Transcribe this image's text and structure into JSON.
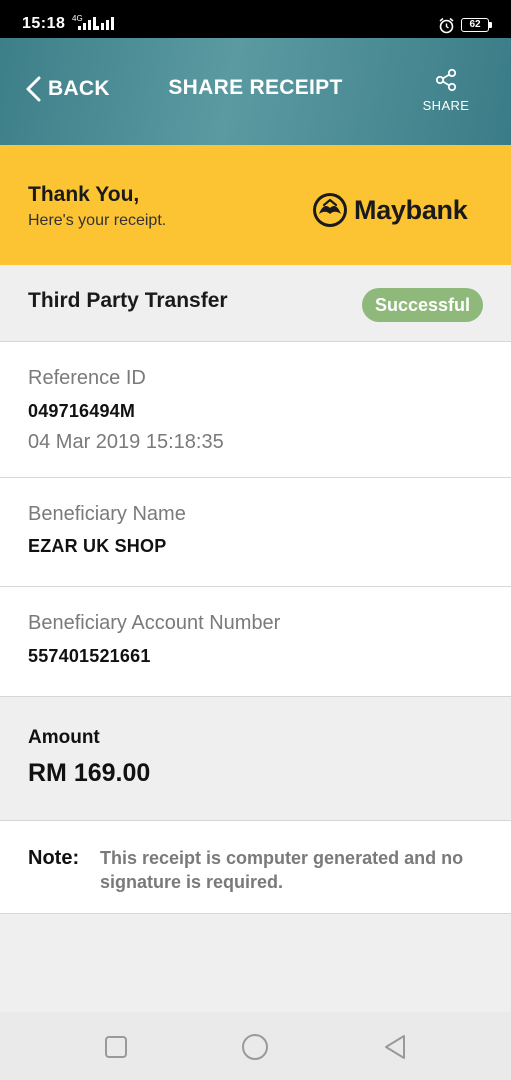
{
  "status_bar": {
    "time": "15:18",
    "network": "4G",
    "battery": "62"
  },
  "header": {
    "back_label": "BACK",
    "title": "SHARE RECEIPT",
    "share_label": "SHARE"
  },
  "banner": {
    "title": "Thank You,",
    "subtitle": "Here's your receipt.",
    "logo_text": "Maybank"
  },
  "transaction": {
    "type": "Third Party Transfer",
    "status": "Successful"
  },
  "reference": {
    "label": "Reference ID",
    "value": "049716494M",
    "datetime": "04 Mar 2019 15:18:35"
  },
  "beneficiary": {
    "label": "Beneficiary Name",
    "value": "EZAR UK SHOP"
  },
  "account": {
    "label": "Beneficiary Account Number",
    "value": "557401521661"
  },
  "amount": {
    "label": "Amount",
    "value": "RM 169.00"
  },
  "note": {
    "label": "Note:",
    "text": "This receipt is computer generated and no signature is required."
  },
  "colors": {
    "header_teal": "#4a8a93",
    "banner_yellow": "#fcc433",
    "success_green": "#8fb97a"
  },
  "icons": [
    "chevron-left-icon",
    "share-icon",
    "maybank-emblem-icon",
    "alarm-icon",
    "square-nav-icon",
    "circle-nav-icon",
    "triangle-nav-icon"
  ]
}
